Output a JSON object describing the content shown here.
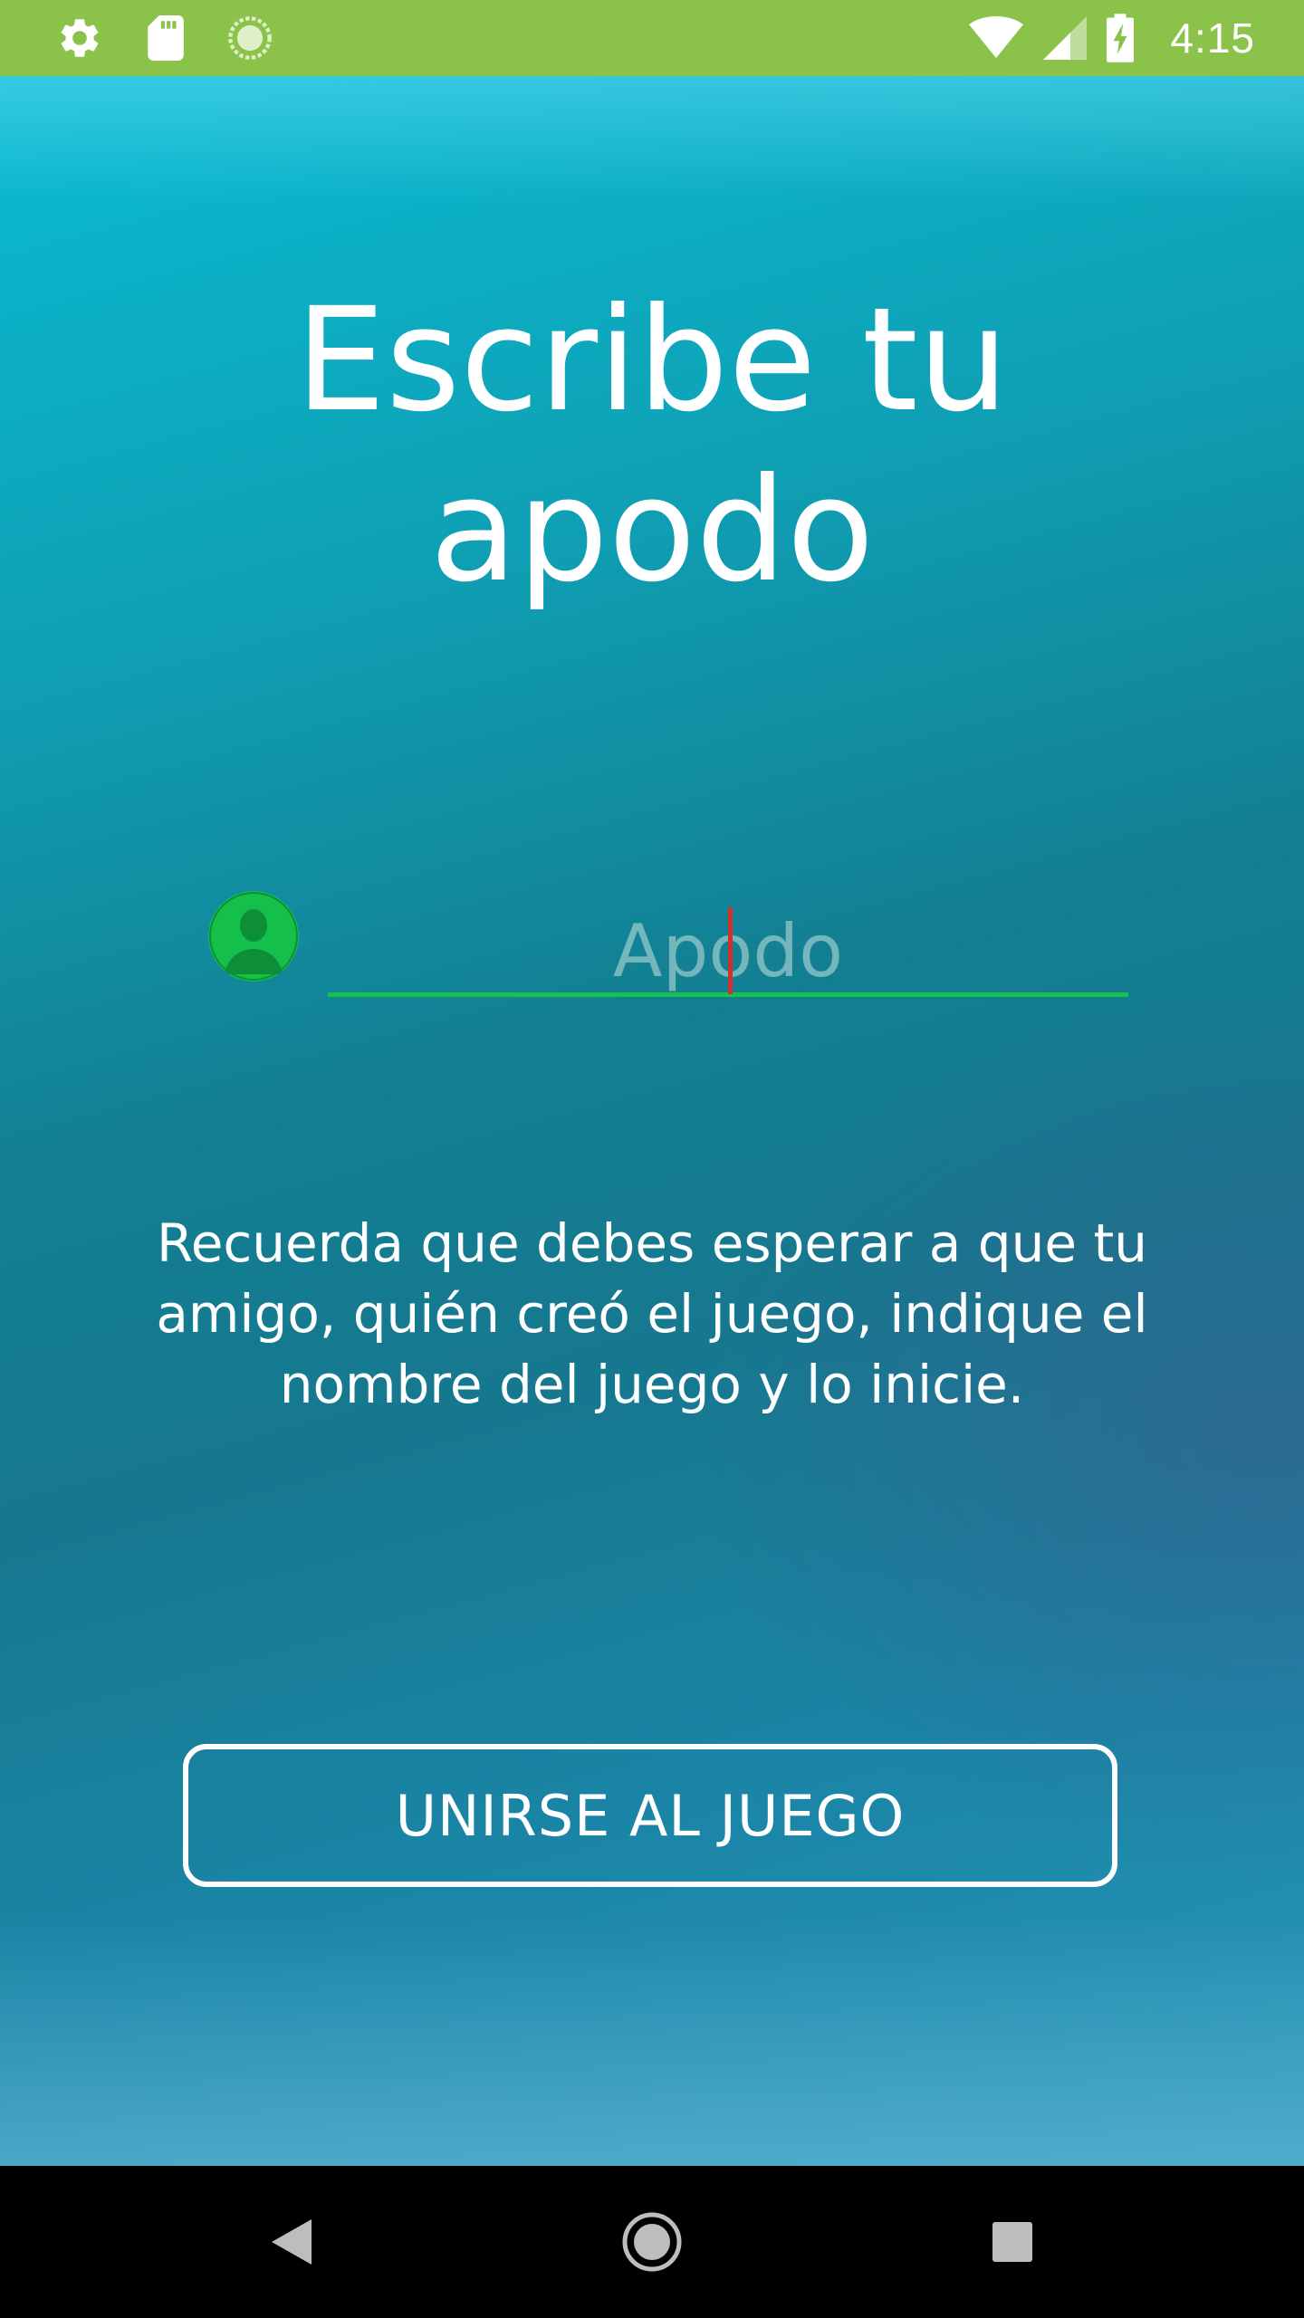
{
  "status_bar": {
    "time": "4:15",
    "left_icons": [
      "gear-icon",
      "sd-card-icon",
      "sync-circle-icon"
    ],
    "right_icons": [
      "wifi-icon",
      "signal-icon",
      "battery-charging-icon"
    ],
    "background": "#8BC34A"
  },
  "screen": {
    "title_line1": "Escribe tu",
    "title_line2": "apodo",
    "nickname_input": {
      "placeholder": "Apodo",
      "value": ""
    },
    "notice": "Recuerda que debes esperar a que tu amigo, quién creó el juego, indique el nombre del juego y lo inicie.",
    "join_button_label": "UNIRSE AL JUEGO",
    "accent_color": "#17C24C"
  },
  "nav_bar": {
    "buttons": [
      "back-icon",
      "home-icon",
      "recents-icon"
    ]
  }
}
